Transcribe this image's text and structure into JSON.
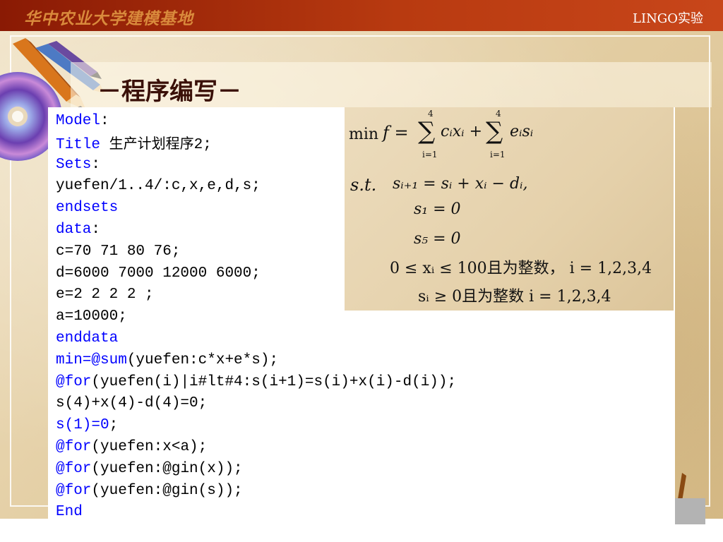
{
  "header": {
    "left_title": "华中农业大学建模基地",
    "right_title": "LINGO实验"
  },
  "slide": {
    "title": "－程序编写－"
  },
  "code": {
    "lines": [
      [
        {
          "t": "Model",
          "k": 1
        },
        {
          "t": ":",
          "k": 0
        }
      ],
      [
        {
          "t": "Title",
          "k": 1
        },
        {
          "t": " ",
          "k": 0
        },
        {
          "t": "生产计划程序",
          "k": 2
        },
        {
          "t": "2;",
          "k": 0
        }
      ],
      [
        {
          "t": "Sets",
          "k": 1
        },
        {
          "t": ":",
          "k": 0
        }
      ],
      [
        {
          "t": "yuefen/1..4/:c,x,e,d,s;",
          "k": 0
        }
      ],
      [
        {
          "t": "endsets",
          "k": 1
        }
      ],
      [
        {
          "t": "data",
          "k": 1
        },
        {
          "t": ":",
          "k": 0
        }
      ],
      [
        {
          "t": "c=70 71 80 76;",
          "k": 0
        }
      ],
      [
        {
          "t": "d=6000 7000 12000 6000;",
          "k": 0
        }
      ],
      [
        {
          "t": "e=2 2 2 2 ;",
          "k": 0
        }
      ],
      [
        {
          "t": "a=10000;",
          "k": 0
        }
      ],
      [
        {
          "t": "enddata",
          "k": 1
        }
      ],
      [
        {
          "t": "min=@sum",
          "k": 1
        },
        {
          "t": "(yuefen:c*x+e*s);",
          "k": 0
        }
      ],
      [
        {
          "t": "@for",
          "k": 1
        },
        {
          "t": "(yuefen(i)|i#lt#4:s(i+1)=s(i)+x(i)-d(i));",
          "k": 0
        }
      ],
      [
        {
          "t": "s(4)+x(4)-d(4)=0;",
          "k": 0
        }
      ],
      [
        {
          "t": "s(1)=0",
          "k": 1
        },
        {
          "t": ";",
          "k": 0
        }
      ],
      [
        {
          "t": "@for",
          "k": 1
        },
        {
          "t": "(yuefen:x<a);",
          "k": 0
        }
      ],
      [
        {
          "t": "@for",
          "k": 1
        },
        {
          "t": "(yuefen:@gin(x));",
          "k": 0
        }
      ],
      [
        {
          "t": "@for",
          "k": 1
        },
        {
          "t": "(yuefen:@gin(s));",
          "k": 0
        }
      ],
      [
        {
          "t": "End",
          "k": 1
        }
      ]
    ]
  },
  "formula": {
    "objective": {
      "min": "min",
      "f_eq": "f =",
      "sum1_top": "4",
      "sum1_bottom": "i=1",
      "term1": "cᵢxᵢ +",
      "sum2_top": "4",
      "sum2_bottom": "i=1",
      "term2": "eᵢsᵢ",
      "sigma": "∑"
    },
    "st": "s.t.",
    "constraints": [
      "sᵢ₊₁ =   sᵢ + xᵢ − dᵢ,",
      "s₁ = 0",
      "s₅ = 0",
      "0 ≤ xᵢ ≤ 100且为整数，   i = 1,2,3,4",
      "sᵢ ≥ 0且为整数          i = 1,2,3,4"
    ]
  },
  "decorations": {
    "disc_icon": "cd-disc-icon",
    "pencil_icon": "pencil-icon",
    "colors": {
      "header_dark": "#8a1a04",
      "header_light": "#c8461a",
      "keyword_blue": "#0000ff",
      "title_brown": "#3a1008"
    }
  }
}
